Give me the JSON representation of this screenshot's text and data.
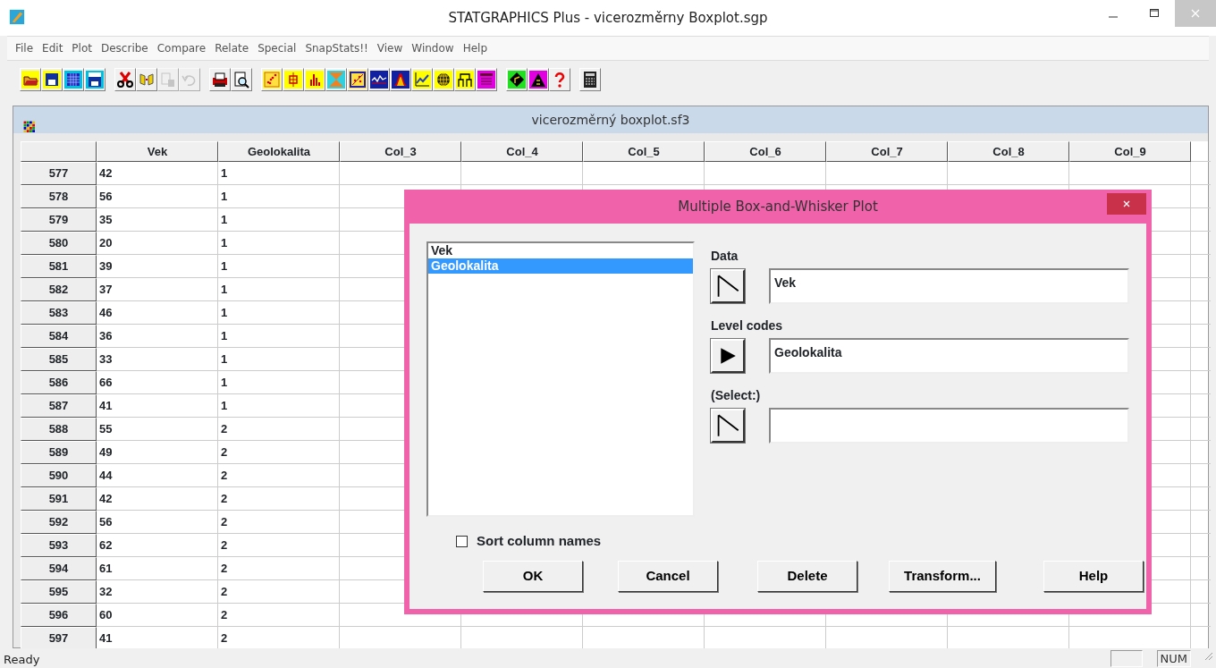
{
  "window": {
    "title": "STATGRAPHICS Plus - vicerozměrny Boxplot.sgp"
  },
  "menu": [
    "File",
    "Edit",
    "Plot",
    "Describe",
    "Compare",
    "Relate",
    "Special",
    "SnapStats!!",
    "View",
    "Window",
    "Help"
  ],
  "toolbar": [
    [
      {
        "kind": "open",
        "disabled": false
      },
      {
        "kind": "save",
        "disabled": false
      },
      {
        "kind": "spreadsheet",
        "disabled": false
      },
      {
        "kind": "datafile",
        "disabled": false
      }
    ],
    [
      {
        "kind": "cut",
        "disabled": false
      },
      {
        "kind": "copy",
        "disabled": false
      },
      {
        "kind": "paste",
        "disabled": true
      },
      {
        "kind": "undo",
        "disabled": true
      }
    ],
    [
      {
        "kind": "print",
        "disabled": false
      },
      {
        "kind": "preview",
        "disabled": false
      }
    ],
    [
      {
        "kind": "scatter",
        "disabled": false
      },
      {
        "kind": "boxplot",
        "disabled": false
      },
      {
        "kind": "histogram",
        "disabled": false
      },
      {
        "kind": "triangles",
        "disabled": false
      },
      {
        "kind": "scatterframe",
        "disabled": false
      },
      {
        "kind": "timeseries",
        "disabled": false
      },
      {
        "kind": "bellcurve",
        "disabled": false
      },
      {
        "kind": "linechart",
        "disabled": false
      },
      {
        "kind": "globe",
        "disabled": false
      },
      {
        "kind": "dendrogram",
        "disabled": false
      },
      {
        "kind": "document",
        "disabled": false
      }
    ],
    [
      {
        "kind": "diamond",
        "disabled": false
      },
      {
        "kind": "pyramid",
        "disabled": false
      },
      {
        "kind": "help",
        "disabled": false
      }
    ],
    [
      {
        "kind": "calculator",
        "disabled": false
      }
    ]
  ],
  "data_window": {
    "title": "vicerozměrný boxplot.sf3",
    "columns": [
      "Vek",
      "Geolokalita",
      "Col_3",
      "Col_4",
      "Col_5",
      "Col_6",
      "Col_7",
      "Col_8",
      "Col_9"
    ],
    "rows": [
      {
        "number": "577",
        "cells": [
          "42",
          "1"
        ]
      },
      {
        "number": "578",
        "cells": [
          "56",
          "1"
        ]
      },
      {
        "number": "579",
        "cells": [
          "35",
          "1"
        ]
      },
      {
        "number": "580",
        "cells": [
          "20",
          "1"
        ]
      },
      {
        "number": "581",
        "cells": [
          "39",
          "1"
        ]
      },
      {
        "number": "582",
        "cells": [
          "37",
          "1"
        ]
      },
      {
        "number": "583",
        "cells": [
          "46",
          "1"
        ]
      },
      {
        "number": "584",
        "cells": [
          "36",
          "1"
        ]
      },
      {
        "number": "585",
        "cells": [
          "33",
          "1"
        ]
      },
      {
        "number": "586",
        "cells": [
          "66",
          "1"
        ]
      },
      {
        "number": "587",
        "cells": [
          "41",
          "1"
        ]
      },
      {
        "number": "588",
        "cells": [
          "55",
          "2"
        ]
      },
      {
        "number": "589",
        "cells": [
          "49",
          "2"
        ]
      },
      {
        "number": "590",
        "cells": [
          "44",
          "2"
        ]
      },
      {
        "number": "591",
        "cells": [
          "42",
          "2"
        ]
      },
      {
        "number": "592",
        "cells": [
          "56",
          "2"
        ]
      },
      {
        "number": "593",
        "cells": [
          "62",
          "2"
        ]
      },
      {
        "number": "594",
        "cells": [
          "61",
          "2"
        ]
      },
      {
        "number": "595",
        "cells": [
          "32",
          "2"
        ]
      },
      {
        "number": "596",
        "cells": [
          "60",
          "2"
        ]
      },
      {
        "number": "597",
        "cells": [
          "41",
          "2"
        ]
      }
    ]
  },
  "dialog": {
    "title": "Multiple Box-and-Whisker Plot",
    "variables": [
      {
        "label": "Vek",
        "selected": false
      },
      {
        "label": "Geolokalita",
        "selected": true
      }
    ],
    "fields": [
      {
        "label": "Data",
        "value": "Vek",
        "active": false
      },
      {
        "label": "Level codes",
        "value": "Geolokalita",
        "active": true
      },
      {
        "label": "(Select:)",
        "active": false
      }
    ],
    "sort_checkbox": {
      "label": "Sort column names",
      "checked": false
    },
    "buttons": [
      "OK",
      "Cancel",
      "Delete",
      "Transform...",
      "Help"
    ]
  },
  "status_bar": {
    "text": "Ready",
    "indicators": [
      "NUM"
    ]
  }
}
